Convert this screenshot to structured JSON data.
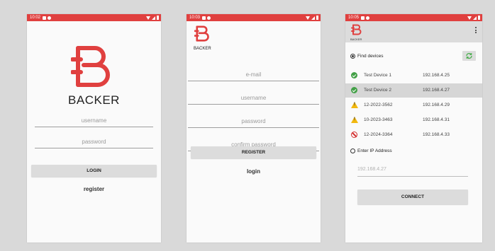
{
  "screen_login": {
    "status_time": "10:02",
    "app_name": "BACKER",
    "username_placeholder": "username",
    "password_placeholder": "password",
    "login_button": "LOGIN",
    "register_link": "register"
  },
  "screen_register": {
    "status_time": "10:03",
    "app_name": "BACKER",
    "email_placeholder": "e-mail",
    "username_placeholder": "username",
    "password_placeholder": "password",
    "confirm_password_placeholder": "confirm password",
    "register_button": "REGISTER",
    "login_link": "login"
  },
  "screen_devices": {
    "status_time": "10:05",
    "app_name": "BACKER",
    "find_devices_label": "Find devices",
    "devices": [
      {
        "name": "Test Device 1",
        "ip": "192.168.4.25",
        "status": "ok"
      },
      {
        "name": "Test Device 2",
        "ip": "192.168.4.27",
        "status": "ok"
      },
      {
        "name": "12-2022-3562",
        "ip": "192.168.4.29",
        "status": "warning"
      },
      {
        "name": "10-2023-3463",
        "ip": "192.168.4.31",
        "status": "warning"
      },
      {
        "name": "12-2024-3364",
        "ip": "192.168.4.33",
        "status": "blocked"
      }
    ],
    "enter_ip_label": "Enter IP Address",
    "ip_placeholder": "192.168.4.27",
    "connect_button": "CONNECT"
  },
  "colors": {
    "brand_red": "#e0403f",
    "ok_green": "#43a047",
    "warning_yellow": "#f2b80f",
    "blocked_red": "#d32f2f",
    "refresh_green": "#4caf50"
  }
}
